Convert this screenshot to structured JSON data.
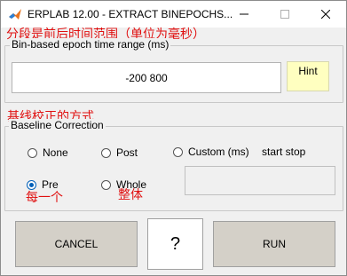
{
  "window": {
    "title": "ERPLAB 12.00   -   EXTRACT BINEPOCHS..."
  },
  "annotations": {
    "time_range_note": "分段是前后时间范围（单位为毫秒）",
    "baseline_note": "基线校正的方式",
    "pre_note": "每一个",
    "whole_note": "整体"
  },
  "epoch_panel": {
    "title": "Bin-based epoch time range (ms)",
    "range_value": "-200  800",
    "hint_label": "Hint"
  },
  "baseline_panel": {
    "title": "Baseline Correction",
    "options": [
      {
        "label": "None",
        "selected": false
      },
      {
        "label": "Post",
        "selected": false
      },
      {
        "label": "Custom (ms)",
        "selected": false
      },
      {
        "label": "Pre",
        "selected": true
      },
      {
        "label": "Whole",
        "selected": false
      }
    ],
    "custom_hint": "start  stop",
    "custom_value": ""
  },
  "buttons": {
    "cancel": "CANCEL",
    "help": "?",
    "run": "RUN"
  },
  "colors": {
    "annotation": "#e01010",
    "hint_bg": "#ffffc0",
    "selected_radio": "#005fb8",
    "button_bg": "#d4d0c8"
  }
}
